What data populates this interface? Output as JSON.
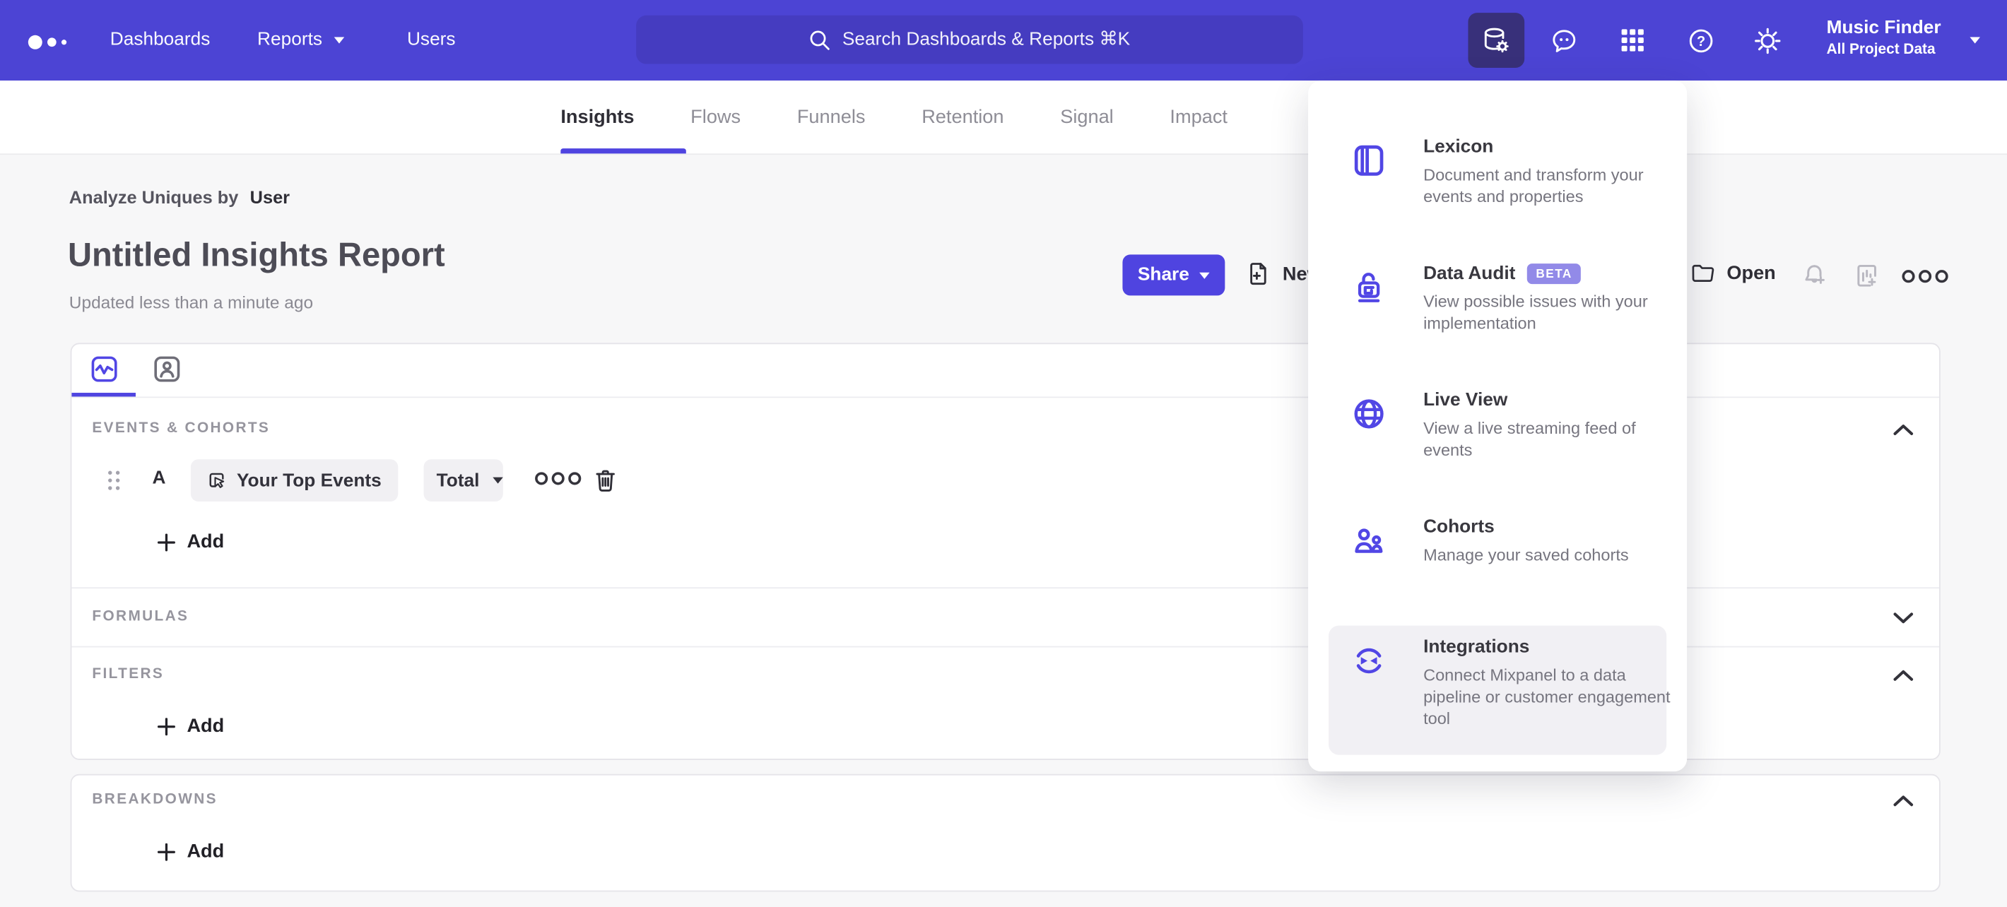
{
  "nav": {
    "items": [
      {
        "label": "Dashboards"
      },
      {
        "label": "Reports"
      },
      {
        "label": "Users"
      }
    ],
    "search_placeholder": "Search Dashboards & Reports ⌘K",
    "project": {
      "name": "Music Finder",
      "scope": "All Project Data"
    }
  },
  "tabs": [
    {
      "label": "Insights",
      "active": true
    },
    {
      "label": "Flows"
    },
    {
      "label": "Funnels"
    },
    {
      "label": "Retention"
    },
    {
      "label": "Signal"
    },
    {
      "label": "Impact"
    }
  ],
  "report": {
    "analyze_prefix": "Analyze Uniques by",
    "analyze_value": "User",
    "title": "Untitled Insights Report",
    "updated": "Updated less than a minute ago",
    "share_label": "Share",
    "new_label": "New",
    "open_label": "Open"
  },
  "query": {
    "events_section": "EVENTS & COHORTS",
    "row": {
      "letter": "A",
      "event": "Your Top Events",
      "aggregation": "Total"
    },
    "add_label": "Add",
    "formulas_section": "FORMULAS",
    "filters_section": "FILTERS",
    "breakdowns_section": "BREAKDOWNS"
  },
  "menu": {
    "items": [
      {
        "title": "Lexicon",
        "description": "Document and transform your events and properties",
        "icon": "book-icon"
      },
      {
        "title": "Data Audit",
        "badge": "BETA",
        "description": "View possible issues with your implementation",
        "icon": "lock-icon"
      },
      {
        "title": "Live View",
        "description": "View a live streaming feed of events",
        "icon": "globe-icon"
      },
      {
        "title": "Cohorts",
        "description": "Manage your saved cohorts",
        "icon": "people-icon"
      },
      {
        "title": "Integrations",
        "description": "Connect Mixpanel to a data pipeline or customer engagement tool",
        "icon": "sync-icon",
        "highlighted": true
      }
    ]
  },
  "colors": {
    "nav_background": "#4c44d4",
    "search_background": "#453cc0",
    "active_tile_background": "#38307a",
    "accent_purple": "#4f44e0",
    "menu_icon_purple": "#5146e5",
    "beta_badge": "#928ae8",
    "page_background": "#f7f7f8"
  }
}
